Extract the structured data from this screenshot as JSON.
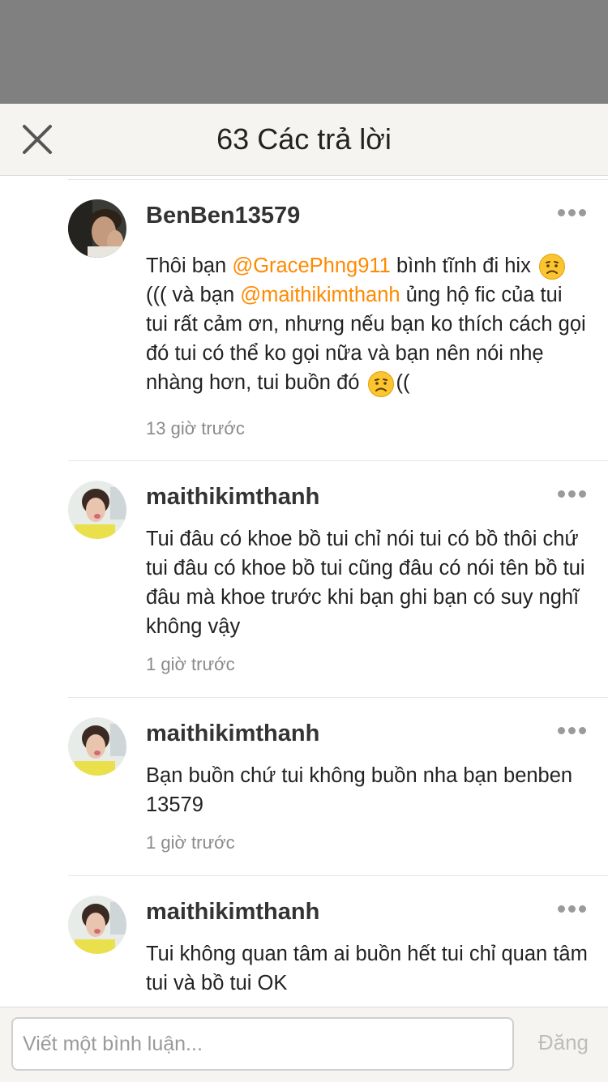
{
  "header": {
    "title": "63 Các trả lời"
  },
  "comments": [
    {
      "username": "BenBen13579",
      "text_before_mention1": "Thôi bạn ",
      "mention1": "@GracePhng911",
      "text_after_mention1": " bình tĩnh đi hix ",
      "text_line2_start": "((( và bạn ",
      "mention2": "@maithikimthanh",
      "text_line2_end": " ủng hộ fic của tui tui rất cảm ơn, nhưng nếu bạn ko thích cách gọi đó tui có thể ko gọi nữa và bạn nên nói nhẹ nhàng hơn, tui buồn đó ",
      "text_end": "((",
      "time": "13 giờ trước"
    },
    {
      "username": "maithikimthanh",
      "text": "Tui đâu có khoe bồ tui chỉ nói tui có bồ thôi chứ tui đâu có khoe bồ tui cũng đâu có nói tên bồ tui đâu mà khoe trước khi bạn ghi bạn có suy nghĩ không vậy",
      "time": "1 giờ trước"
    },
    {
      "username": "maithikimthanh",
      "text": "Bạn buồn chứ tui không buồn nha bạn benben 13579",
      "time": "1 giờ trước"
    },
    {
      "username": "maithikimthanh",
      "text": "Tui không quan tâm ai buồn hết tui chỉ quan tâm tui và bồ tui OK",
      "time": ""
    }
  ],
  "footer": {
    "input_placeholder": "Viết một bình luận...",
    "post_label": "Đăng"
  },
  "colors": {
    "mention": "#ff8a00",
    "overlay": "#808080",
    "header_bg": "#f5f4f0"
  },
  "icons": {
    "close": "close-icon",
    "more": "more-dots-icon",
    "emoji": "worried-face-emoji"
  }
}
